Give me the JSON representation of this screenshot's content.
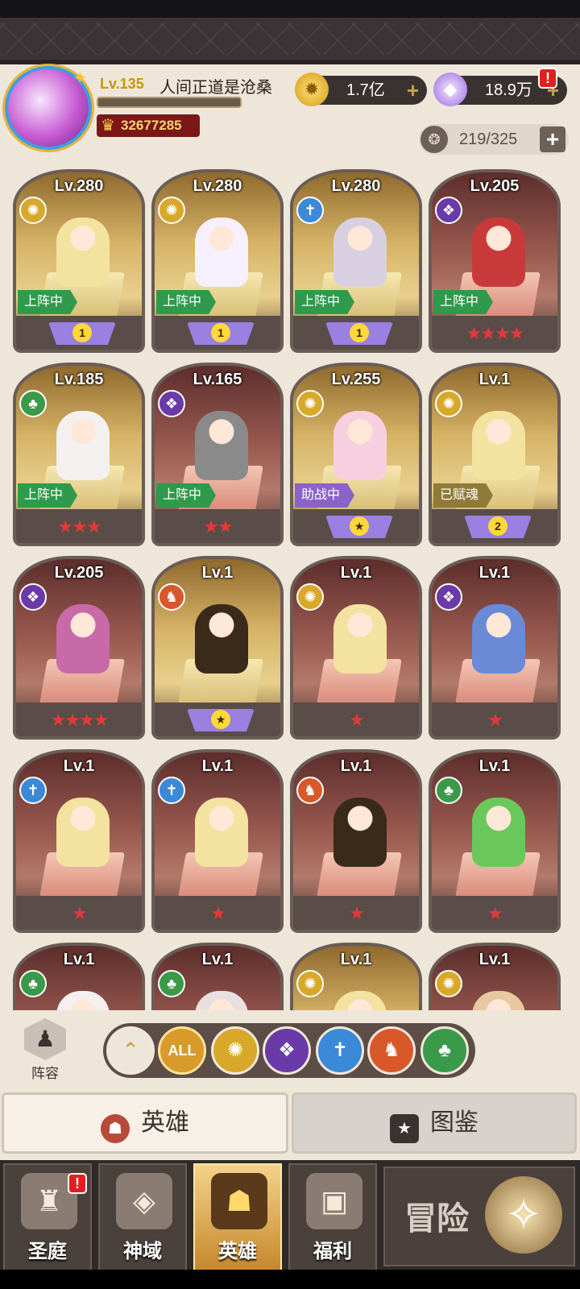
{
  "player": {
    "level": "Lv.135",
    "name": "人间正道是沧桑",
    "xp_fraction": 0.0,
    "power": "32677285"
  },
  "currencies": {
    "gold": "1.7亿",
    "gems": "18.9万",
    "gem_alert": "!"
  },
  "hero_capacity": "219/325",
  "colors": {
    "light": "#d8a82a",
    "dark": "#6a3aa8",
    "holy": "#3a8ad8",
    "beast": "#d8582a",
    "nature": "#3a9a4a"
  },
  "heroes": [
    {
      "level": "Lv.280",
      "faction": "light",
      "status": "上阵中",
      "rank": "1",
      "stars": "",
      "theme": "gold"
    },
    {
      "level": "Lv.280",
      "faction": "light",
      "status": "上阵中",
      "rank": "1",
      "stars": "",
      "theme": "gold"
    },
    {
      "level": "Lv.280",
      "faction": "holy",
      "status": "上阵中",
      "rank": "1",
      "stars": "",
      "theme": "gold"
    },
    {
      "level": "Lv.205",
      "faction": "dark",
      "status": "上阵中",
      "rank": "",
      "stars": "★★★★",
      "theme": "red"
    },
    {
      "level": "Lv.185",
      "faction": "nature",
      "status": "上阵中",
      "rank": "",
      "stars": "★★★",
      "theme": "gold"
    },
    {
      "level": "Lv.165",
      "faction": "dark",
      "status": "上阵中",
      "rank": "",
      "stars": "★★",
      "theme": "red"
    },
    {
      "level": "Lv.255",
      "faction": "light",
      "status": "助战中",
      "rank": "★",
      "stars": "",
      "theme": "gold"
    },
    {
      "level": "Lv.1",
      "faction": "light",
      "status": "已赋魂",
      "rank": "2",
      "stars": "",
      "theme": "gold"
    },
    {
      "level": "Lv.205",
      "faction": "dark",
      "status": "",
      "rank": "",
      "stars": "★★★★",
      "theme": "red"
    },
    {
      "level": "Lv.1",
      "faction": "beast",
      "status": "",
      "rank": "★",
      "stars": "",
      "theme": "gold"
    },
    {
      "level": "Lv.1",
      "faction": "light",
      "status": "",
      "rank": "",
      "stars": "★",
      "theme": "red"
    },
    {
      "level": "Lv.1",
      "faction": "dark",
      "status": "",
      "rank": "",
      "stars": "★",
      "theme": "red"
    },
    {
      "level": "Lv.1",
      "faction": "holy",
      "status": "",
      "rank": "",
      "stars": "★",
      "theme": "red"
    },
    {
      "level": "Lv.1",
      "faction": "holy",
      "status": "",
      "rank": "",
      "stars": "★",
      "theme": "red"
    },
    {
      "level": "Lv.1",
      "faction": "beast",
      "status": "",
      "rank": "",
      "stars": "★",
      "theme": "red"
    },
    {
      "level": "Lv.1",
      "faction": "nature",
      "status": "",
      "rank": "",
      "stars": "★",
      "theme": "red"
    },
    {
      "level": "Lv.1",
      "faction": "nature",
      "status": "",
      "rank": "",
      "stars": "",
      "theme": "red"
    },
    {
      "level": "Lv.1",
      "faction": "nature",
      "status": "",
      "rank": "",
      "stars": "",
      "theme": "red"
    },
    {
      "level": "Lv.1",
      "faction": "light",
      "status": "",
      "rank": "",
      "stars": "",
      "theme": "gold"
    },
    {
      "level": "Lv.1",
      "faction": "light",
      "status": "",
      "rank": "",
      "stars": "",
      "theme": "red"
    }
  ],
  "lineup": {
    "label": "阵容"
  },
  "filters": {
    "all_label": "ALL",
    "icons": [
      "collapse-icon",
      "all",
      "light-faction-icon",
      "dark-faction-icon",
      "holy-faction-icon",
      "beast-faction-icon",
      "nature-faction-icon"
    ]
  },
  "main_tabs": {
    "heroes": "英雄",
    "codex": "图鉴"
  },
  "nav": {
    "sanctuary": "圣庭",
    "divine_realm": "神域",
    "heroes": "英雄",
    "welfare": "福利",
    "adventure": "冒险",
    "sanctuary_alert": "!"
  }
}
